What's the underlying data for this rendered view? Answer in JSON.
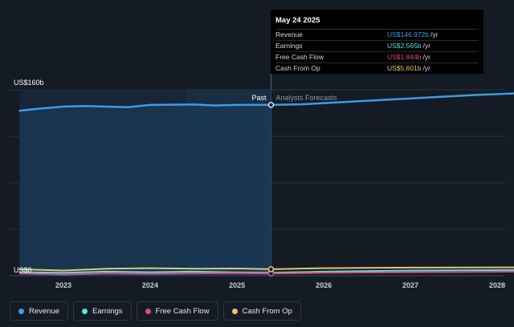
{
  "chart_data": {
    "type": "line",
    "x_ticks": [
      "2023",
      "2024",
      "2025",
      "2026",
      "2027",
      "2028"
    ],
    "y_ticks": [
      "US$160b",
      "US$0"
    ],
    "ylim": [
      0,
      160
    ],
    "past_label": "Past",
    "forecast_label": "Analysts Forecasts",
    "series": [
      {
        "name": "Revenue",
        "color": "#3d9be9",
        "points": [
          [
            "2022-07-01",
            142.0
          ],
          [
            "2022-10-01",
            144.0
          ],
          [
            "2023-01-01",
            145.5
          ],
          [
            "2023-04-01",
            146.0
          ],
          [
            "2023-07-01",
            145.5
          ],
          [
            "2023-10-01",
            145.0
          ],
          [
            "2024-01-01",
            147.0
          ],
          [
            "2024-04-01",
            147.2
          ],
          [
            "2024-07-01",
            147.3
          ],
          [
            "2024-10-01",
            146.5
          ],
          [
            "2025-01-01",
            147.0
          ],
          [
            "2025-05-24",
            146.972
          ],
          [
            "2025-10-01",
            147.5
          ],
          [
            "2026-04-01",
            149.5
          ],
          [
            "2026-10-01",
            151.5
          ],
          [
            "2027-04-01",
            153.5
          ],
          [
            "2027-10-01",
            155.5
          ],
          [
            "2028-04-01",
            157.0
          ]
        ]
      },
      {
        "name": "Earnings",
        "color": "#5fe0d4",
        "points": [
          [
            "2022-07-01",
            3.0
          ],
          [
            "2023-01-01",
            2.5
          ],
          [
            "2023-07-01",
            3.5
          ],
          [
            "2024-01-01",
            3.0
          ],
          [
            "2024-07-01",
            3.5
          ],
          [
            "2025-01-01",
            2.8
          ],
          [
            "2025-05-24",
            2.565
          ],
          [
            "2026-01-01",
            3.5
          ],
          [
            "2027-01-01",
            4.5
          ],
          [
            "2028-04-01",
            5.0
          ]
        ]
      },
      {
        "name": "Free Cash Flow",
        "color": "#d74d8b",
        "points": [
          [
            "2022-07-01",
            2.0
          ],
          [
            "2023-01-01",
            1.0
          ],
          [
            "2023-07-01",
            2.0
          ],
          [
            "2024-01-01",
            1.5
          ],
          [
            "2024-07-01",
            2.0
          ],
          [
            "2025-01-01",
            2.2
          ],
          [
            "2025-05-24",
            1.844
          ],
          [
            "2026-01-01",
            2.5
          ],
          [
            "2027-01-01",
            3.0
          ],
          [
            "2028-04-01",
            3.5
          ]
        ]
      },
      {
        "name": "Cash From Op",
        "color": "#eec170",
        "points": [
          [
            "2022-07-01",
            5.5
          ],
          [
            "2023-01-01",
            4.5
          ],
          [
            "2023-07-01",
            6.0
          ],
          [
            "2024-01-01",
            6.5
          ],
          [
            "2024-07-01",
            6.0
          ],
          [
            "2025-01-01",
            6.2
          ],
          [
            "2025-05-24",
            5.601
          ],
          [
            "2026-01-01",
            6.5
          ],
          [
            "2027-01-01",
            7.0
          ],
          [
            "2028-04-01",
            7.2
          ]
        ]
      }
    ]
  },
  "tooltip": {
    "date": "May 24 2025",
    "rows": [
      {
        "label": "Revenue",
        "value": "US$146.972b",
        "unit": "/yr",
        "color": "#3d9be9"
      },
      {
        "label": "Earnings",
        "value": "US$2.565b",
        "unit": "/yr",
        "color": "#5fe0d4"
      },
      {
        "label": "Free Cash Flow",
        "value": "US$1.844b",
        "unit": "/yr",
        "color": "#d74d8b"
      },
      {
        "label": "Cash From Op",
        "value": "US$5.601b",
        "unit": "/yr",
        "color": "#eec170"
      }
    ]
  },
  "legend": [
    {
      "label": "Revenue",
      "color": "#3d9be9"
    },
    {
      "label": "Earnings",
      "color": "#5fe0d4"
    },
    {
      "label": "Free Cash Flow",
      "color": "#d74d8b"
    },
    {
      "label": "Cash From Op",
      "color": "#eec170"
    }
  ]
}
